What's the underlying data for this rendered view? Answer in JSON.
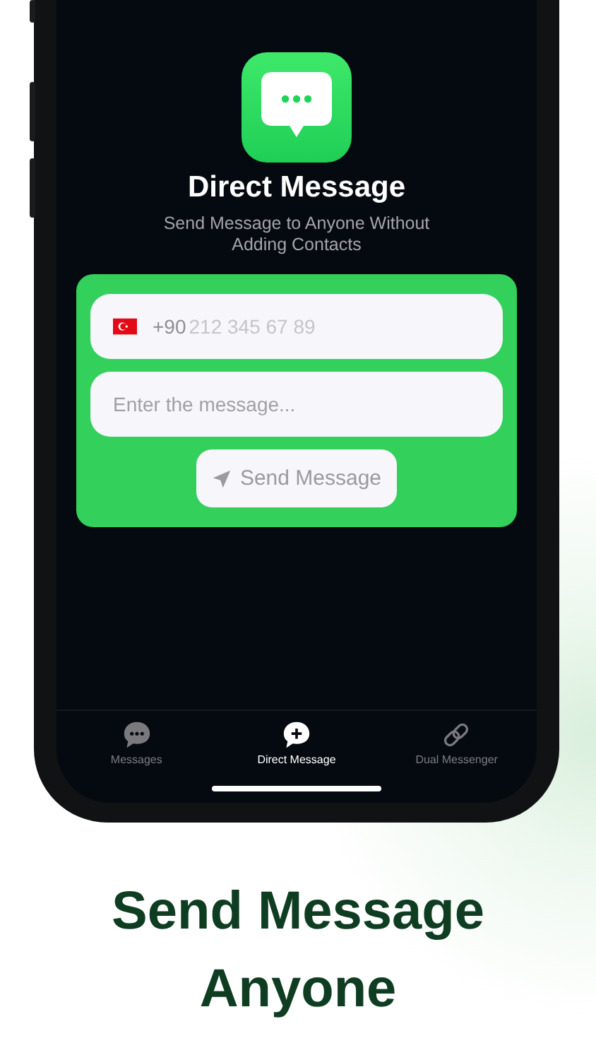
{
  "app": {
    "title": "Direct Message",
    "subtitle": "Send Message to Anyone Without Adding Contacts"
  },
  "form": {
    "country_code": "+90",
    "phone_placeholder": "212 345 67 89",
    "message_placeholder": "Enter the message...",
    "send_button": "Send Message"
  },
  "tabs": [
    {
      "label": "Messages",
      "kind": "messages",
      "selected": false
    },
    {
      "label": "Direct Message",
      "kind": "direct",
      "selected": true
    },
    {
      "label": "Dual Messenger",
      "kind": "link",
      "selected": false
    }
  ],
  "caption": "Send Message Anyone"
}
